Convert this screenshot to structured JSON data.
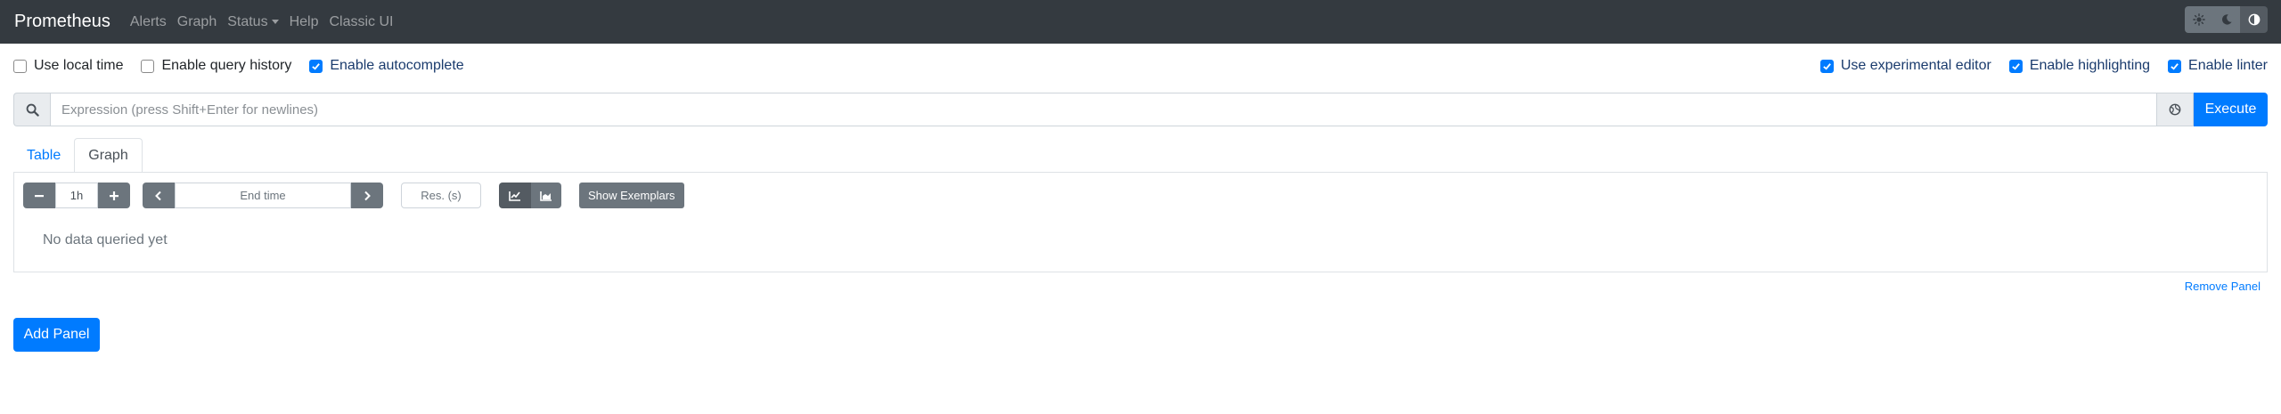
{
  "navbar": {
    "brand": "Prometheus",
    "links": [
      "Alerts",
      "Graph",
      "Status",
      "Help",
      "Classic UI"
    ],
    "theme_icons": [
      "sun-icon",
      "moon-icon",
      "half-circle-icon"
    ]
  },
  "options_left": [
    {
      "label": "Use local time",
      "checked": false
    },
    {
      "label": "Enable query history",
      "checked": false
    },
    {
      "label": "Enable autocomplete",
      "checked": true
    }
  ],
  "options_right": [
    {
      "label": "Use experimental editor",
      "checked": true
    },
    {
      "label": "Enable highlighting",
      "checked": true
    },
    {
      "label": "Enable linter",
      "checked": true
    }
  ],
  "expression": {
    "placeholder": "Expression (press Shift+Enter for newlines)",
    "execute_label": "Execute"
  },
  "tabs": [
    "Table",
    "Graph"
  ],
  "panel": {
    "range": "1h",
    "end_time_placeholder": "End time",
    "resolution_placeholder": "Res. (s)",
    "show_exemplars": "Show Exemplars",
    "no_data": "No data queried yet"
  },
  "remove_panel": "Remove Panel",
  "add_panel": "Add Panel",
  "colors": {
    "navbar": "#343a40",
    "primary": "#007bff",
    "secondary": "#6c757d"
  }
}
